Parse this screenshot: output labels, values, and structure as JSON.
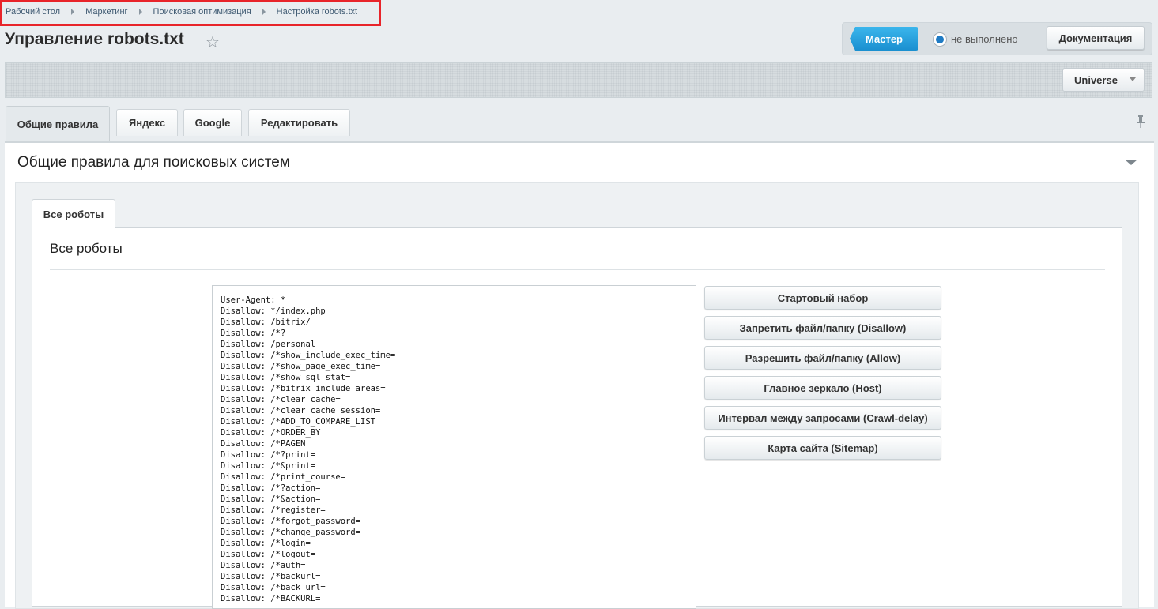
{
  "breadcrumb": [
    "Рабочий стол",
    "Маркетинг",
    "Поисковая оптимизация",
    "Настройка robots.txt"
  ],
  "page": {
    "title": "Управление robots.txt"
  },
  "header": {
    "master_label": "Мастер",
    "status_text": "не выполнено",
    "docs_label": "Документация",
    "site_select": "Universe"
  },
  "tabs": [
    "Общие правила",
    "Яндекс",
    "Google",
    "Редактировать"
  ],
  "section": {
    "title": "Общие правила для поисковых систем"
  },
  "inner": {
    "tab": "Все роботы",
    "title": "Все роботы"
  },
  "robots_text": "User-Agent: *\nDisallow: */index.php\nDisallow: /bitrix/\nDisallow: /*?\nDisallow: /personal\nDisallow: /*show_include_exec_time=\nDisallow: /*show_page_exec_time=\nDisallow: /*show_sql_stat=\nDisallow: /*bitrix_include_areas=\nDisallow: /*clear_cache=\nDisallow: /*clear_cache_session=\nDisallow: /*ADD_TO_COMPARE_LIST\nDisallow: /*ORDER_BY\nDisallow: /*PAGEN\nDisallow: /*?print=\nDisallow: /*&print=\nDisallow: /*print_course=\nDisallow: /*?action=\nDisallow: /*&action=\nDisallow: /*register=\nDisallow: /*forgot_password=\nDisallow: /*change_password=\nDisallow: /*login=\nDisallow: /*logout=\nDisallow: /*auth=\nDisallow: /*backurl=\nDisallow: /*back_url=\nDisallow: /*BACKURL=",
  "actions": [
    "Стартовый набор",
    "Запретить файл/папку (Disallow)",
    "Разрешить файл/папку (Allow)",
    "Главное зеркало (Host)",
    "Интервал между запросами (Crawl-delay)",
    "Карта сайта (Sitemap)"
  ],
  "colors": {
    "accent": "#1f8fd3",
    "highlight_border": "#e8242a"
  }
}
